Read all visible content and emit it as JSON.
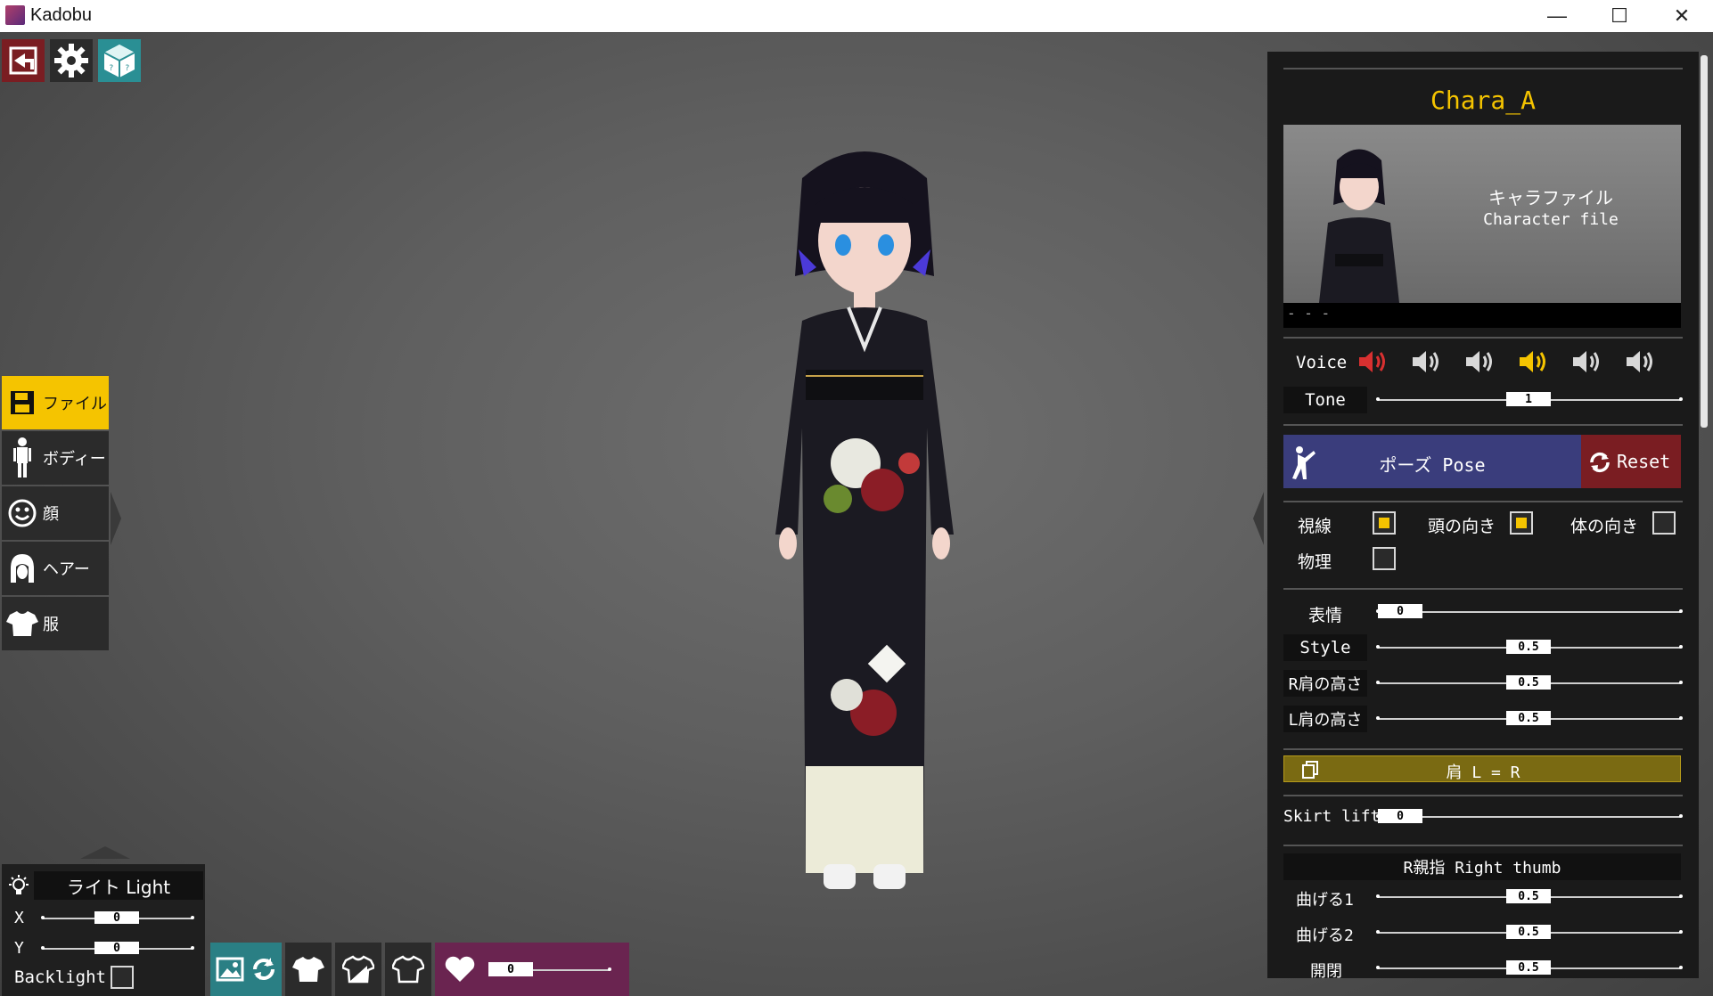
{
  "window": {
    "title": "Kadobu",
    "minimize": "—",
    "maximize": "☐",
    "close": "✕"
  },
  "toolbar": {
    "back": "back-icon",
    "settings": "gear-icon",
    "random": "dice-icon"
  },
  "left_menu": [
    {
      "label": "ファイル",
      "icon": "floppy-icon",
      "active": true
    },
    {
      "label": "ボディー",
      "icon": "body-icon",
      "active": false
    },
    {
      "label": "顔",
      "icon": "face-icon",
      "active": false
    },
    {
      "label": "ヘアー",
      "icon": "hair-icon",
      "active": false
    },
    {
      "label": "服",
      "icon": "shirt-icon",
      "active": false
    }
  ],
  "light": {
    "title": "ライト Light",
    "x_label": "X",
    "x_value": "0",
    "y_label": "Y",
    "y_value": "0",
    "backlight_label": "Backlight",
    "backlight": false
  },
  "bottom": {
    "heart_value": "0"
  },
  "right_panel": {
    "chara_name": "Chara_A",
    "file_label_jp": "キャラファイル",
    "file_label_en": "Character file",
    "file_status": "- - -",
    "voice_label": "Voice",
    "voice_selected_index": 3,
    "tone_label": "Tone",
    "tone_value": "1",
    "pose_label": "ポーズ Pose",
    "reset_label": "Reset",
    "gaze_label": "視線",
    "gaze": true,
    "head_dir_label": "頭の向き",
    "head_dir": true,
    "body_dir_label": "体の向き",
    "body_dir": false,
    "physics_label": "物理",
    "physics": false,
    "expression_label": "表情",
    "expression_value": "0",
    "style_label": "Style",
    "style_value": "0.5",
    "r_shoulder_label": "R肩の高さ",
    "r_shoulder_value": "0.5",
    "l_shoulder_label": "L肩の高さ",
    "l_shoulder_value": "0.5",
    "shoulder_sync_label": "肩 L = R",
    "skirt_label": "Skirt lift",
    "skirt_value": "0",
    "thumb_header": "R親指 Right thumb",
    "bend1_label": "曲げる1",
    "bend1_value": "0.5",
    "bend2_label": "曲げる2",
    "bend2_value": "0.5",
    "spread_label": "開閉",
    "spread_value": "0.5"
  },
  "colors": {
    "accent": "#f5c400",
    "active_voice": "#d93030",
    "pose": "#3a3d7c",
    "reset": "#7a1d22",
    "sync": "#7a6a12",
    "bottom_teal": "#2a7f84",
    "bottom_heart": "#6a2450"
  }
}
